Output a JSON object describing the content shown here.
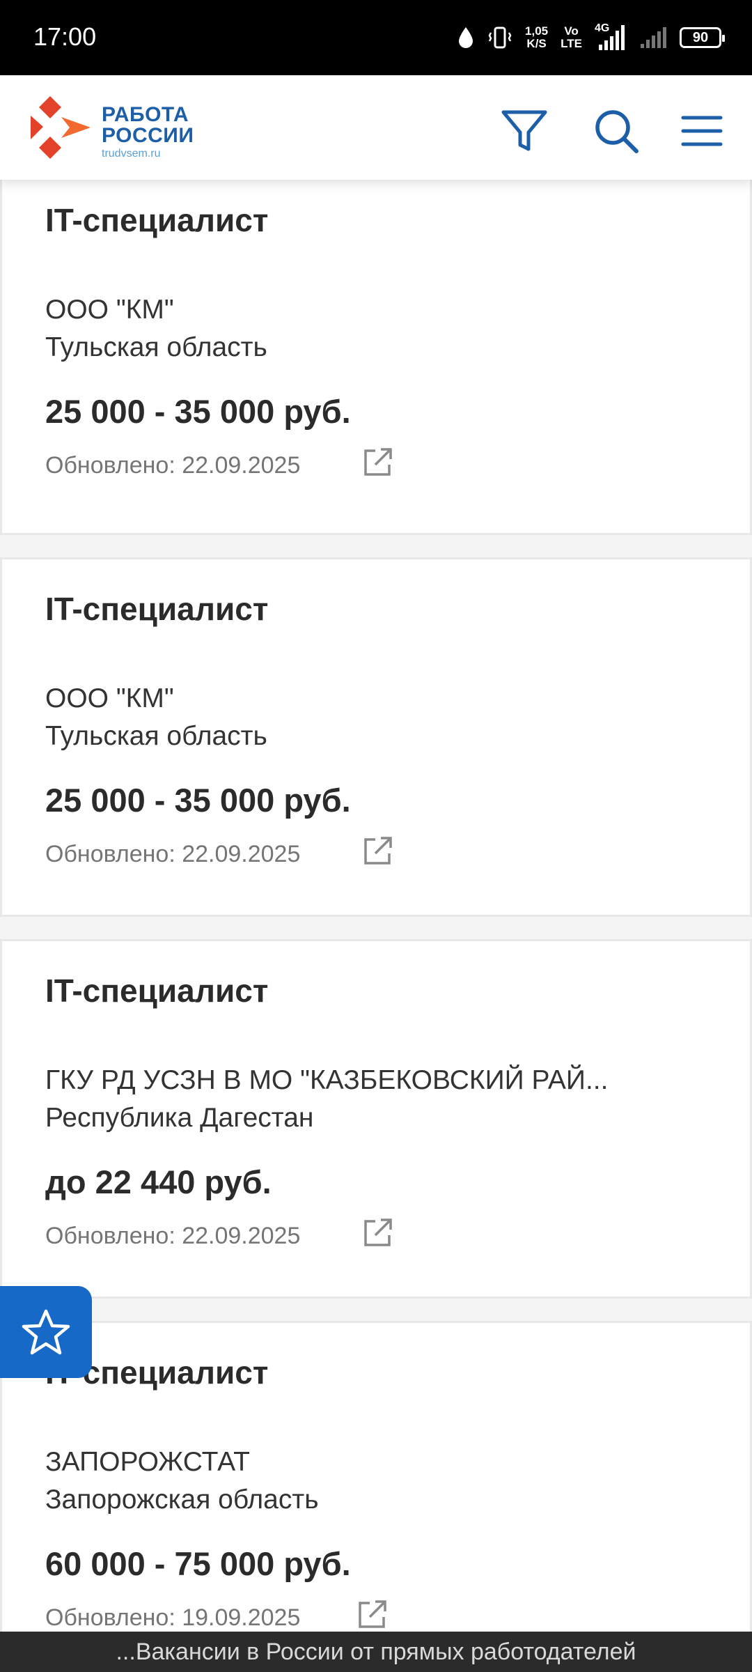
{
  "status_bar": {
    "time": "17:00",
    "net_speed_value": "1,05",
    "net_speed_unit": "K/S",
    "volte_top": "Vo",
    "volte_bottom": "LTE",
    "network": "4G",
    "battery": "90"
  },
  "header": {
    "logo_line1": "РАБОТА",
    "logo_line2": "РОССИИ",
    "logo_url": "trudvsem.ru",
    "icons": [
      "filter-icon",
      "search-icon",
      "menu-icon"
    ],
    "accent_color": "#1c5fa8",
    "logo_colors": [
      "#e4412b",
      "#f26a2f"
    ]
  },
  "vacancies": [
    {
      "title": "IT-специалист",
      "employer": "ООО \"КМ\"",
      "region": "Тульская область",
      "salary": "25 000 - 35 000 руб.",
      "updated": "Обновлено: 22.09.2025"
    },
    {
      "title": "IT-специалист",
      "employer": "ООО \"КМ\"",
      "region": "Тульская область",
      "salary": "25 000 - 35 000 руб.",
      "updated": "Обновлено: 22.09.2025"
    },
    {
      "title": "IT-специалист",
      "employer": "ГКУ РД УСЗН В МО \"КАЗБЕКОВСКИЙ РАЙ...",
      "region": "Республика Дагестан",
      "salary": "до 22 440 руб.",
      "updated": "Обновлено: 22.09.2025"
    },
    {
      "title": "IT-специалист",
      "employer": "ЗАПОРОЖСТАТ",
      "region": "Запорожская область",
      "salary": "60 000 - 75 000 руб.",
      "updated": "Обновлено: 19.09.2025"
    }
  ],
  "favorites_button": {
    "icon": "star-icon",
    "color": "#1669c7"
  },
  "bottom_banner": "...Вакансии в России от прямых работодателей"
}
